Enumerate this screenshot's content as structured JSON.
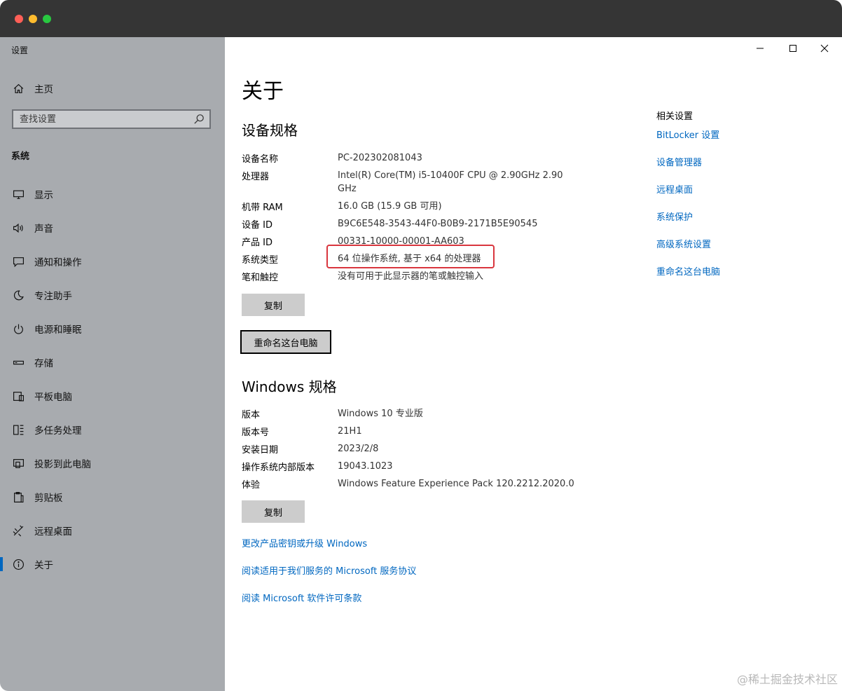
{
  "window": {
    "app_title": "设置"
  },
  "sidebar": {
    "home_label": "主页",
    "search_placeholder": "查找设置",
    "section_label": "系统",
    "items": [
      {
        "label": "显示",
        "icon": "monitor-icon"
      },
      {
        "label": "声音",
        "icon": "speaker-icon"
      },
      {
        "label": "通知和操作",
        "icon": "notification-icon"
      },
      {
        "label": "专注助手",
        "icon": "moon-icon"
      },
      {
        "label": "电源和睡眠",
        "icon": "power-icon"
      },
      {
        "label": "存储",
        "icon": "storage-icon"
      },
      {
        "label": "平板电脑",
        "icon": "tablet-icon"
      },
      {
        "label": "多任务处理",
        "icon": "multitask-icon"
      },
      {
        "label": "投影到此电脑",
        "icon": "project-icon"
      },
      {
        "label": "剪贴板",
        "icon": "clipboard-icon"
      },
      {
        "label": "远程桌面",
        "icon": "remote-desktop-icon"
      },
      {
        "label": "关于",
        "icon": "info-icon",
        "active": true
      }
    ]
  },
  "main": {
    "title": "关于",
    "device_section": {
      "heading": "设备规格",
      "rows": [
        {
          "key": "设备名称",
          "value": "PC-202302081043"
        },
        {
          "key": "处理器",
          "value": "Intel(R) Core(TM) i5-10400F CPU @ 2.90GHz   2.90 GHz"
        },
        {
          "key": "机带 RAM",
          "value": "16.0 GB (15.9 GB 可用)"
        },
        {
          "key": "设备 ID",
          "value": "B9C6E548-3543-44F0-B0B9-2171B5E90545"
        },
        {
          "key": "产品 ID",
          "value": "00331-10000-00001-AA603"
        },
        {
          "key": "系统类型",
          "value": "64 位操作系统, 基于 x64 的处理器"
        },
        {
          "key": "笔和触控",
          "value": "没有可用于此显示器的笔或触控输入"
        }
      ],
      "copy_label": "复制",
      "rename_label": "重命名这台电脑"
    },
    "windows_section": {
      "heading": "Windows 规格",
      "rows": [
        {
          "key": "版本",
          "value": "Windows 10 专业版"
        },
        {
          "key": "版本号",
          "value": "21H1"
        },
        {
          "key": "安装日期",
          "value": "2023/2/8"
        },
        {
          "key": "操作系统内部版本",
          "value": "19043.1023"
        },
        {
          "key": "体验",
          "value": "Windows Feature Experience Pack 120.2212.2020.0"
        }
      ],
      "copy_label": "复制"
    },
    "links": [
      "更改产品密钥或升级 Windows",
      "阅读适用于我们服务的 Microsoft 服务协议",
      "阅读 Microsoft 软件许可条款"
    ]
  },
  "related": {
    "title": "相关设置",
    "links": [
      "BitLocker 设置",
      "设备管理器",
      "远程桌面",
      "系统保护",
      "高级系统设置",
      "重命名这台电脑"
    ]
  },
  "watermark": "@稀土掘金技术社区",
  "colors": {
    "accent": "#0067c0",
    "highlight": "#d9363e",
    "sidebar_bg": "#a8abaf"
  }
}
